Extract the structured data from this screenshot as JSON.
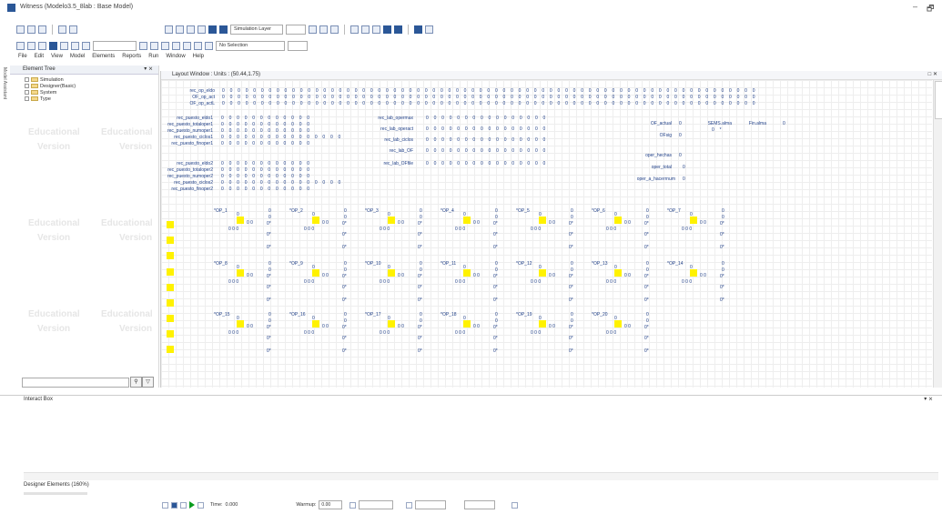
{
  "window": {
    "title": "Witness (Modelo3.5_8lab : Base Model)",
    "minimize": "–",
    "maximize": "🗗"
  },
  "toolbar": {
    "layer_combo": "Simulation Layer",
    "selection_combo": "No Selection"
  },
  "menu": [
    "File",
    "Edit",
    "View",
    "Model",
    "Elements",
    "Reports",
    "Run",
    "Window",
    "Help"
  ],
  "sidebar": {
    "model_assistant": "Model Assistant"
  },
  "element_tree": {
    "title": "Element Tree",
    "controls": "▾ ⨯",
    "items": [
      "Simulation",
      "Designer(Basic)",
      "System",
      "Type"
    ],
    "watermark": [
      "Educational",
      "Version"
    ]
  },
  "layout_window": {
    "title": "Layout Window : Units : (50.44,1.75)",
    "controls": "□ ✕",
    "top_labels": [
      "rec_op_eldo",
      "OF_op_act",
      "OF_op_actL"
    ],
    "zero_row_long": "0 0 0 0 0 0 0 0 0 0 0 0 0 0 0 0 0 0 0 0 0 0 0 0 0 0 0 0 0 0 0 0 0 0 0 0 0 0 0 0 0 0 0 0 0 0 0 0 0 0 0 0 0 0 0 0 0 0 0 0 0 0 0 0 0 0 0 0 0",
    "rec1_labels": [
      "rec_puesto_eldo1",
      "rec_puesto_totaloper1",
      "rec_puesto_numoper1",
      "rec_puesto_ciclos1",
      "rec_puesto_finoper1"
    ],
    "rec2_labels": [
      "rec_puesto_eldo2",
      "rec_puesto_totaloper2",
      "rec_puesto_numoper2",
      "rec_puesto_ciclos2",
      "rec_puesto_finoper2"
    ],
    "zero_row_med": "0 0 0 0 0 0 0 0 0 0 0 0",
    "zero_row_ciclos": "0 0 0 0 0 0 0 0 0 0 0 0 0 0 0 0",
    "lab_labels": [
      "rec_lab_opermax",
      "rec_lab_operact",
      "rec_lab_ciclos",
      "rec_lab_OF",
      "rec_lab_OFfile"
    ],
    "zero_row_lab": "0 0 0 0 0 0 0 0 0 0 0 0 0 0 0 0",
    "stats": [
      {
        "label": "OF_actual",
        "value": "0"
      },
      {
        "label": "OFsig",
        "value": "0"
      },
      {
        "label": "oper_hechas",
        "value": "0"
      },
      {
        "label": "oper_total",
        "value": "0"
      },
      {
        "label": "oper_a_hacerrnum",
        "value": "0"
      }
    ],
    "sems": {
      "label": "SEMS.alma",
      "value": "0 *"
    },
    "fin": {
      "label": "Fin.alma",
      "value": "0"
    },
    "op_rows": [
      [
        "*OP_1",
        "*OP_2",
        "*OP_3",
        "*OP_4",
        "*OP_5",
        "*OP_6",
        "*OP_7"
      ],
      [
        "*OP_8",
        "*OP_9",
        "*OP_10",
        "*OP_11",
        "*OP_12",
        "*OP_13",
        "*OP_14"
      ],
      [
        "*OP_15",
        "*OP_16",
        "*OP_17",
        "*OP_18",
        "*OP_19",
        "*OP_20"
      ]
    ],
    "op_zero": "0",
    "op_triple": "0 0 0",
    "op_double": "0 0",
    "op_mark": "0*"
  },
  "interact_box": {
    "title": "Interact Box",
    "controls": "▾ ⨯"
  },
  "designer_elements": {
    "label": "Designer Elements (160%)"
  },
  "status": {
    "time_label": "Time:",
    "time_value": "0.000",
    "warmup_label": "Warmup:",
    "warmup_value": "0.00"
  },
  "colors": {
    "accent": "#2b5797",
    "label_blue": "#1f3f87",
    "part_yellow": "#fff200"
  }
}
